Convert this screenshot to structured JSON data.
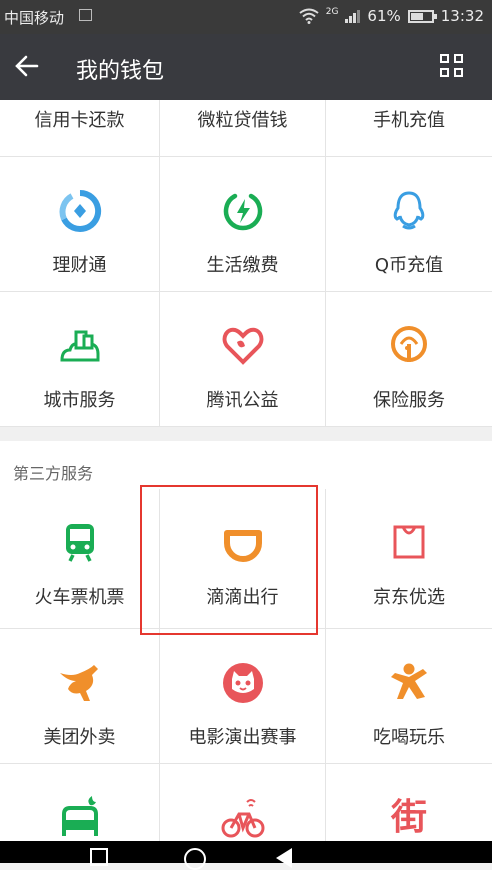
{
  "status_bar": {
    "carrier": "中国移动",
    "network": "2G",
    "battery_pct": "61%",
    "time": "13:32"
  },
  "header": {
    "title": "我的钱包"
  },
  "rows": [
    {
      "items": [
        {
          "label": "信用卡还款",
          "icon": "credit-card-icon"
        },
        {
          "label": "微粒贷借钱",
          "icon": "loan-icon"
        },
        {
          "label": "手机充值",
          "icon": "mobile-topup-icon"
        }
      ]
    },
    {
      "items": [
        {
          "label": "理财通",
          "icon": "wealth-icon"
        },
        {
          "label": "生活缴费",
          "icon": "bill-payment-icon"
        },
        {
          "label": "Q币充值",
          "icon": "qq-coin-icon"
        }
      ]
    },
    {
      "items": [
        {
          "label": "城市服务",
          "icon": "city-services-icon"
        },
        {
          "label": "腾讯公益",
          "icon": "charity-heart-icon"
        },
        {
          "label": "保险服务",
          "icon": "insurance-icon"
        }
      ]
    },
    {
      "items": [
        {
          "label": "火车票机票",
          "icon": "train-icon"
        },
        {
          "label": "滴滴出行",
          "icon": "didi-icon"
        },
        {
          "label": "京东优选",
          "icon": "jd-bag-icon"
        }
      ]
    },
    {
      "items": [
        {
          "label": "美团外卖",
          "icon": "kangaroo-icon"
        },
        {
          "label": "电影演出赛事",
          "icon": "cat-face-icon"
        },
        {
          "label": "吃喝玩乐",
          "icon": "person-fun-icon"
        }
      ]
    },
    {
      "items": [
        {
          "label": "",
          "icon": "hotel-bed-icon"
        },
        {
          "label": "",
          "icon": "bike-icon"
        },
        {
          "label": "",
          "icon": "street-char-icon",
          "glyph": "街"
        }
      ]
    }
  ],
  "section": {
    "title": "第三方服务"
  },
  "colors": {
    "header_bg": "#393a3f",
    "blue": "#3a9ee2",
    "green": "#1aad54",
    "red": "#e8555a",
    "orange": "#f08f2b",
    "highlight": "#e5372f"
  }
}
